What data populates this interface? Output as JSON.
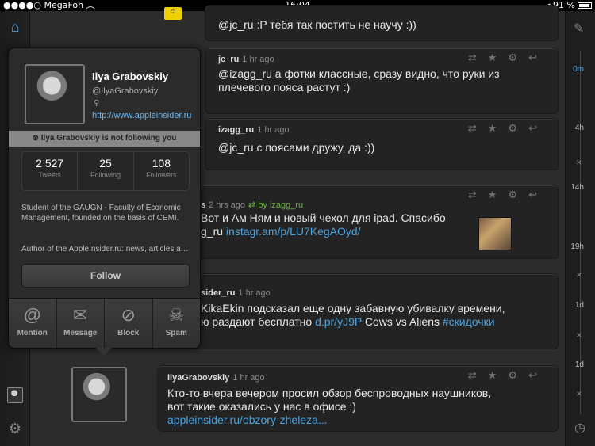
{
  "status_bar": {
    "carrier": "MegaFon",
    "time": "16:04",
    "battery": "91 %",
    "battery_level": 0.91
  },
  "sidebar": {
    "home_icon": "home-icon",
    "settings_icon": "gear-icon"
  },
  "timeline": {
    "marks": [
      "0m",
      "4h",
      "14h",
      "19h",
      "1d",
      "1d"
    ]
  },
  "tweets": [
    {
      "user": "",
      "ago": "",
      "text": "@jc_ru :P тебя так постить не научу :))"
    },
    {
      "user": "jc_ru",
      "ago": "1 hr ago",
      "text": "@izagg_ru а фотки классные, сразу видно, что руки из плечевого пояса растут :)"
    },
    {
      "user": "izagg_ru",
      "ago": "1 hr ago",
      "text": "@jc_ru с поясами дружу, да :))"
    },
    {
      "user": "s",
      "ago": "2 hrs ago",
      "rt_by": "by izagg_ru",
      "text": "Вот и Ам Ням и новый чехол для ipad. Спасибо",
      "text2_prefix": "g_ru ",
      "link": "instagr.am/p/LU7KegAOyd/"
    },
    {
      "user": "sider_ru",
      "ago": "1 hr ago",
      "text": "KikaEkin подсказал еще одну забавную убивалку времени,",
      "text2_prefix": "ю раздают бесплатно ",
      "link": "d.pr/yJ9P",
      "text2_suffix": " Cows vs Aliens ",
      "hashtag": "#скидочки"
    },
    {
      "user": "IlyaGrabovskiy",
      "ago": "1 hr ago",
      "text": "Кто-то вчера вечером просил обзор беспроводных наушников,",
      "text2": "вот такие оказались у нас в офисе :)",
      "link": "appleinsider.ru/obzory-zheleza..."
    }
  ],
  "profile": {
    "name": "Ilya Grabovskiy",
    "handle": "@IlyaGrabovskiy",
    "url": "http://www.appleinsider.ru",
    "follow_status": "Ilya Grabovskiy is not following you",
    "stats": [
      {
        "num": "2 527",
        "label": "Tweets"
      },
      {
        "num": "25",
        "label": "Following"
      },
      {
        "num": "108",
        "label": "Followers"
      }
    ],
    "bio": "Student of the GAUGN - Faculty of Economic Management, founded on the basis of CEMI.",
    "bio2": "Author of the AppleInsider.ru: news, articles and reviews",
    "follow_button": "Follow",
    "actions": [
      {
        "label": "Mention",
        "icon": "at-icon"
      },
      {
        "label": "Message",
        "icon": "envelope-icon"
      },
      {
        "label": "Block",
        "icon": "block-icon"
      },
      {
        "label": "Spam",
        "icon": "skull-icon"
      }
    ]
  }
}
